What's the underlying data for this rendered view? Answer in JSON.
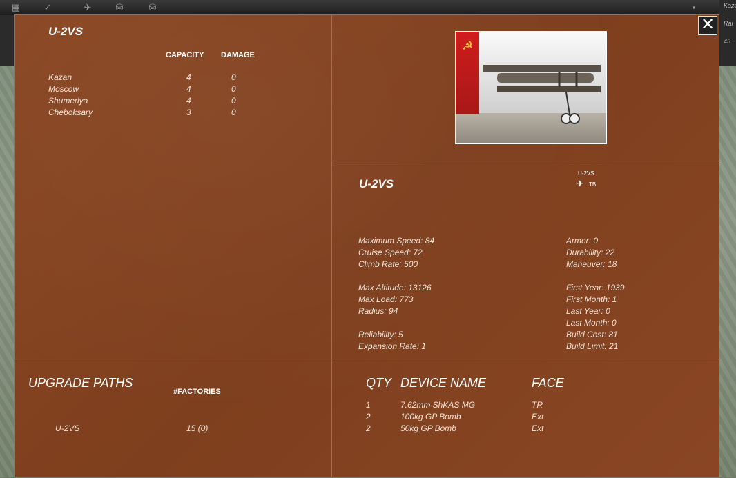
{
  "header": {
    "right_strip": [
      "Kaza",
      "Rai",
      "45"
    ]
  },
  "left_panel": {
    "title": "U-2VS",
    "columns": [
      "CAPACITY",
      "DAMAGE"
    ],
    "factories": [
      {
        "name": "Kazan",
        "capacity": "4",
        "damage": "0"
      },
      {
        "name": "Moscow",
        "capacity": "4",
        "damage": "0"
      },
      {
        "name": "Shumerlya",
        "capacity": "4",
        "damage": "0"
      },
      {
        "name": "Cheboksary",
        "capacity": "3",
        "damage": "0"
      }
    ]
  },
  "photo": {
    "flag_symbol": "☭"
  },
  "stats_panel": {
    "title": "U-2VS",
    "badge_name": "U-2VS",
    "badge_type": "TB",
    "left_stats": [
      "Maximum Speed: 84",
      "Cruise Speed: 72",
      "Climb Rate: 500",
      "Max Altitude: 13126",
      "Max Load: 773",
      "Radius: 94",
      "Reliability: 5",
      "Expansion Rate: 1"
    ],
    "right_stats": [
      "Armor: 0",
      "Durability: 22",
      "Maneuver: 18",
      "First Year: 1939",
      "First Month: 1",
      "Last Year: 0",
      "Last Month: 0",
      "Build Cost: 81",
      "Build Limit: 21"
    ]
  },
  "upgrade_panel": {
    "title": "UPGRADE PATHS",
    "factories_header": "#FACTORIES",
    "rows": [
      {
        "name": "U-2VS",
        "factories": "15 (0)"
      }
    ]
  },
  "device_panel": {
    "headers": [
      "QTY",
      "DEVICE NAME",
      "FACE"
    ],
    "rows": [
      {
        "qty": "1",
        "name": "7.62mm ShKAS MG",
        "face": "TR"
      },
      {
        "qty": "2",
        "name": "100kg GP Bomb",
        "face": "Ext"
      },
      {
        "qty": "2",
        "name": "50kg GP Bomb",
        "face": "Ext"
      }
    ]
  },
  "close_label": "✕"
}
